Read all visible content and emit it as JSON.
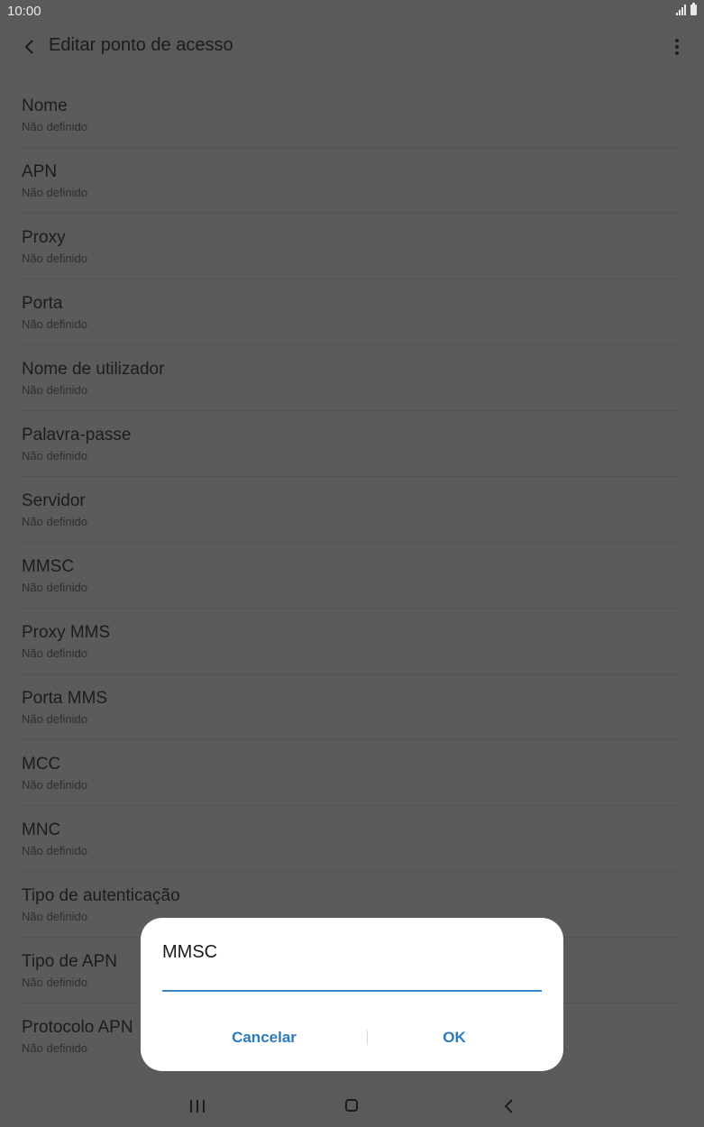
{
  "status_bar": {
    "time": "10:00"
  },
  "app_bar": {
    "title": "Editar ponto de acesso"
  },
  "fields": [
    {
      "label": "Nome",
      "value": "Não definido"
    },
    {
      "label": "APN",
      "value": "Não definido"
    },
    {
      "label": "Proxy",
      "value": "Não definido"
    },
    {
      "label": "Porta",
      "value": "Não definido"
    },
    {
      "label": "Nome de utilizador",
      "value": "Não definido"
    },
    {
      "label": "Palavra-passe",
      "value": "Não definido"
    },
    {
      "label": "Servidor",
      "value": "Não definido"
    },
    {
      "label": "MMSC",
      "value": "Não definido"
    },
    {
      "label": "Proxy MMS",
      "value": "Não definido"
    },
    {
      "label": "Porta MMS",
      "value": "Não definido"
    },
    {
      "label": "MCC",
      "value": "Não definido"
    },
    {
      "label": "MNC",
      "value": "Não definido"
    },
    {
      "label": "Tipo de autenticação",
      "value": "Não definido"
    },
    {
      "label": "Tipo de APN",
      "value": "Não definido"
    },
    {
      "label": "Protocolo APN",
      "value": "Não definido"
    }
  ],
  "dialog": {
    "title": "MMSC",
    "input_value": "",
    "cancel_label": "Cancelar",
    "ok_label": "OK"
  },
  "colors": {
    "accent": "#2a7ac0",
    "input_underline": "#3a86c8",
    "scrim_background": "#5a5a5a"
  },
  "icons": {
    "back": "chevron-left-icon",
    "more": "more-vertical-icon",
    "signal": "signal-icon",
    "battery": "battery-icon",
    "nav_recent": "recent-apps-icon",
    "nav_home": "home-icon",
    "nav_back": "nav-back-icon"
  }
}
